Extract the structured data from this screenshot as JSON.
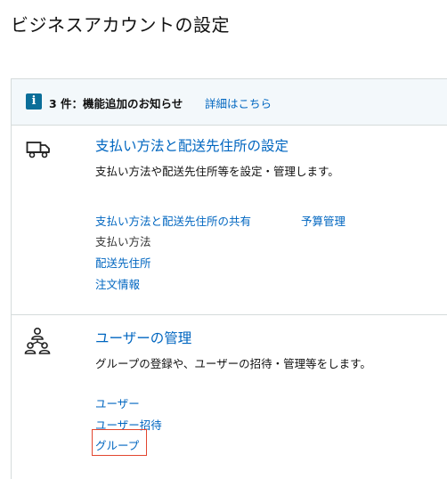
{
  "page": {
    "title": "ビジネスアカウントの設定"
  },
  "notice": {
    "icon": "info-icon",
    "text": "3 件：機能追加のお知らせ",
    "link": "詳細はこちら"
  },
  "payment_section": {
    "icon": "delivery-truck-icon",
    "title": "支払い方法と配送先住所の設定",
    "description": "支払い方法や配送先住所等を設定・管理します。",
    "links": {
      "shared": "支払い方法と配送先住所の共有",
      "budget": "予算管理",
      "payment_method": "支払い方法",
      "shipping_address": "配送先住所",
      "order_info": "注文情報"
    }
  },
  "users_section": {
    "icon": "user-group-icon",
    "title": "ユーザーの管理",
    "description": "グループの登録や、ユーザーの招待・管理等をします。",
    "links": {
      "users": "ユーザー",
      "invite": "ユーザー招待",
      "group": "グループ"
    }
  },
  "colors": {
    "link": "#0066c0",
    "highlight": "#e2462f",
    "notice_bg": "#f3f8fb",
    "info_icon": "#0b6e99"
  }
}
